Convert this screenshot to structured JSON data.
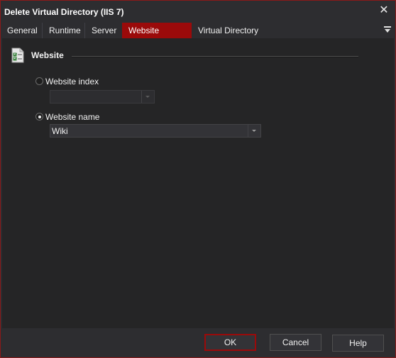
{
  "window": {
    "title": "Delete Virtual Directory (IIS 7)"
  },
  "tabs": [
    {
      "label": "General",
      "active": false
    },
    {
      "label": "Runtime",
      "active": false
    },
    {
      "label": "Server",
      "active": false
    },
    {
      "label": "Website Options",
      "active": true
    },
    {
      "label": "Virtual Directory Options",
      "active": false
    }
  ],
  "group": {
    "title": "Website",
    "icon": "checklist-document-icon"
  },
  "options": {
    "website_index": {
      "label": "Website index",
      "selected": false,
      "value": ""
    },
    "website_name": {
      "label": "Website name",
      "selected": true,
      "value": "Wiki"
    }
  },
  "buttons": {
    "ok": "OK",
    "cancel": "Cancel",
    "help": "Help"
  },
  "colors": {
    "accent": "#9b0a0a",
    "background": "#2d2d30",
    "panel": "#252526"
  }
}
